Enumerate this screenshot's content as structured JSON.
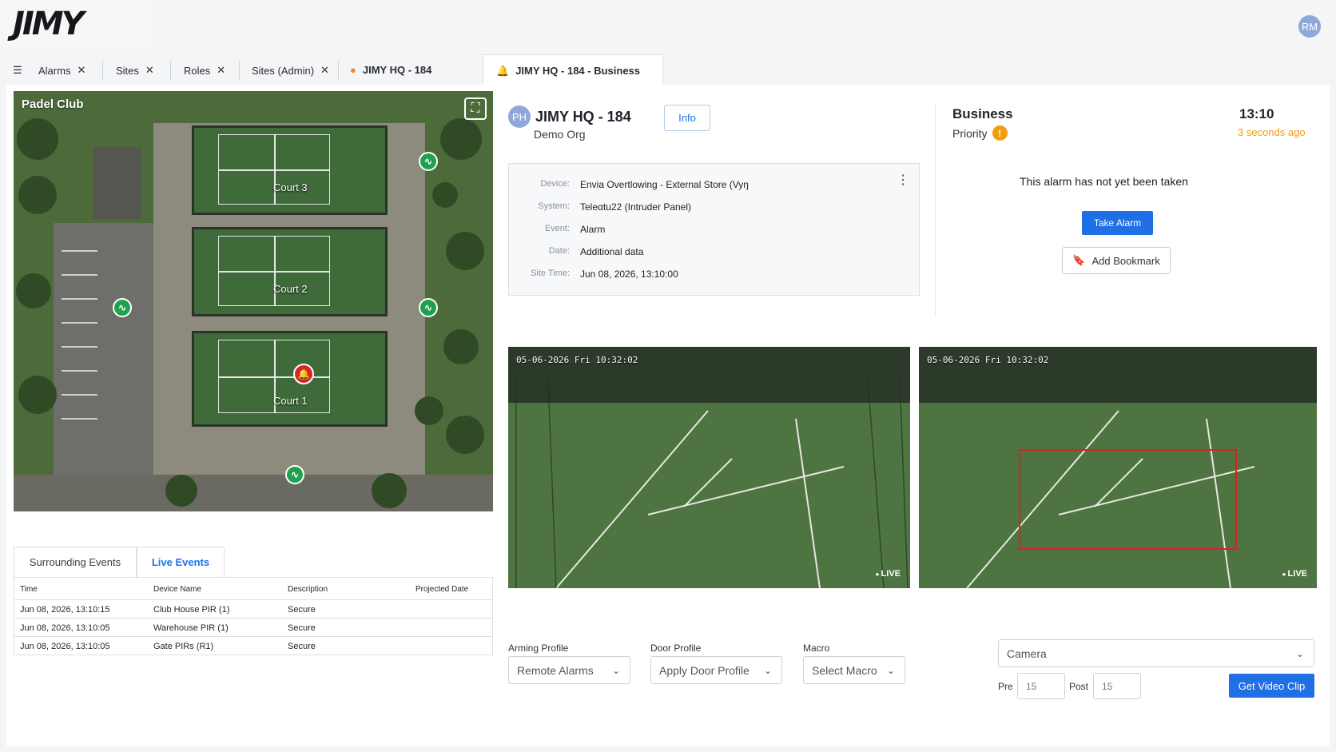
{
  "brand": {
    "logo_text": "JIMY"
  },
  "user": {
    "initials": "RM"
  },
  "tabs": [
    {
      "label": "Alarms",
      "closable": true
    },
    {
      "label": "Sites",
      "closable": true
    },
    {
      "label": "Roles",
      "closable": true
    },
    {
      "label": "Sites (Admin)",
      "closable": true
    },
    {
      "label": "JIMY HQ - 184",
      "icon": "flame-icon"
    },
    {
      "label": "JIMY HQ - 184 - Business",
      "icon": "bell-icon",
      "active": true
    }
  ],
  "map": {
    "title": "Padel Club",
    "courts": [
      "Court 3",
      "Court 2",
      "Court 1"
    ]
  },
  "events": {
    "tabs": [
      "Surrounding Events",
      "Live Events"
    ],
    "active_tab": "Live Events",
    "columns": [
      "Time",
      "Device Name",
      "Description",
      "Projected Date"
    ],
    "rows": [
      {
        "time": "Jun 08, 2026, 13:10:15",
        "device": "Club House PIR (1)",
        "description": "Secure",
        "projected": ""
      },
      {
        "time": "Jun 08, 2026, 13:10:05",
        "device": "Warehouse PIR (1)",
        "description": "Secure",
        "projected": ""
      },
      {
        "time": "Jun 08, 2026, 13:10:05",
        "device": "Gate PIRs (R1)",
        "description": "Secure",
        "projected": ""
      }
    ]
  },
  "site": {
    "initials": "PH",
    "name": "JIMY HQ - 184",
    "org": "Demo Org",
    "info_label": "Info"
  },
  "details": {
    "device_label": "Device:",
    "device": "Envia Overtlowing - External Store (Vyŋ",
    "system_label": "System:",
    "system": "Teleαtu22 (Intruder Panel)",
    "event_label": "Event:",
    "event": "Alarm",
    "date_label": "Date:",
    "date": "Additional data",
    "site_time_label": "Site Time:",
    "site_time": "Jun 08, 2026, 13:10:00"
  },
  "alarm": {
    "type": "Business",
    "priority_label": "Priority",
    "time": "13:10",
    "ago": "3 seconds ago",
    "status": "This alarm has not yet been taken",
    "take_label": "Take Alarm",
    "bookmark_label": "Add Bookmark"
  },
  "cameras": [
    {
      "timestamp": "05-06-2026 Fri 10:32:02",
      "status": "LIVE"
    },
    {
      "timestamp": "05-06-2026 Fri 10:32:02",
      "status": "LIVE"
    }
  ],
  "controls": {
    "arming_label": "Arming Profile",
    "arming_value": "Remote Alarms",
    "door_label": "Door Profile",
    "door_value": "Apply Door Profile",
    "macro_label": "Macro",
    "macro_value": "Select Macro",
    "camera_placeholder": "Camera",
    "pre_label": "Pre",
    "pre_value": "15",
    "post_label": "Post",
    "post_value": "15",
    "clip_label": "Get Video Clip"
  },
  "colors": {
    "accent": "#1f6fe5",
    "alarm": "#d82727",
    "sensor_ok": "#21a150",
    "warning": "#f39c12"
  }
}
